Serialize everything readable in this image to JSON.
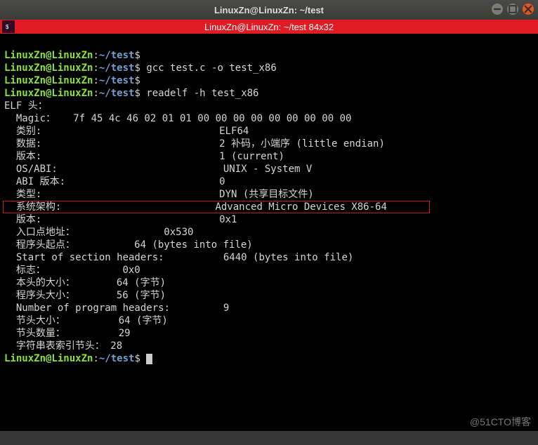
{
  "window": {
    "title": "LinuxZn@LinuxZn: ~/test",
    "tab_title": "LinuxZn@LinuxZn: ~/test 84x32"
  },
  "prompt": {
    "user_host": "LinuxZn@LinuxZn",
    "sep": ":",
    "path": "~/test",
    "sigil": "$"
  },
  "cmds": {
    "c0": "",
    "c1": "gcc test.c -o test_x86",
    "c2": "",
    "c3": "readelf -h test_x86",
    "c4": ""
  },
  "out": {
    "l00": "ELF 头：",
    "l01": "  Magic：   7f 45 4c 46 02 01 01 00 00 00 00 00 00 00 00 00 ",
    "l02a": "  类别:                              ",
    "l02b": "ELF64",
    "l03a": "  数据:                              ",
    "l03b": "2 补码，小端序 (little endian)",
    "l04a": "  版本:                              ",
    "l04b": "1 (current)",
    "l05a": "  OS/ABI:                            ",
    "l05b": "UNIX - System V",
    "l06a": "  ABI 版本:                          ",
    "l06b": "0",
    "l07a": "  类型:                              ",
    "l07b": "DYN (共享目标文件)",
    "l08a": "  系统架构:                          ",
    "l08b": "Advanced Micro Devices X86-64",
    "l09a": "  版本:                              ",
    "l09b": "0x1",
    "l10a": "  入口点地址：               ",
    "l10b": "0x530",
    "l11a": "  程序头起点：          ",
    "l11b": "64 (bytes into file)",
    "l12a": "  Start of section headers:          ",
    "l12b": "6440 (bytes into file)",
    "l13a": "  标志：             ",
    "l13b": "0x0",
    "l14a": "  本头的大小：       ",
    "l14b": "64 (字节)",
    "l15a": "  程序头大小：       ",
    "l15b": "56 (字节)",
    "l16a": "  Number of program headers:         ",
    "l16b": "9",
    "l17a": "  节头大小：         ",
    "l17b": "64 (字节)",
    "l18a": "  节头数量：         ",
    "l18b": "29",
    "l19a": "  字符串表索引节头： ",
    "l19b": "28"
  },
  "watermark": "@51CTO博客"
}
